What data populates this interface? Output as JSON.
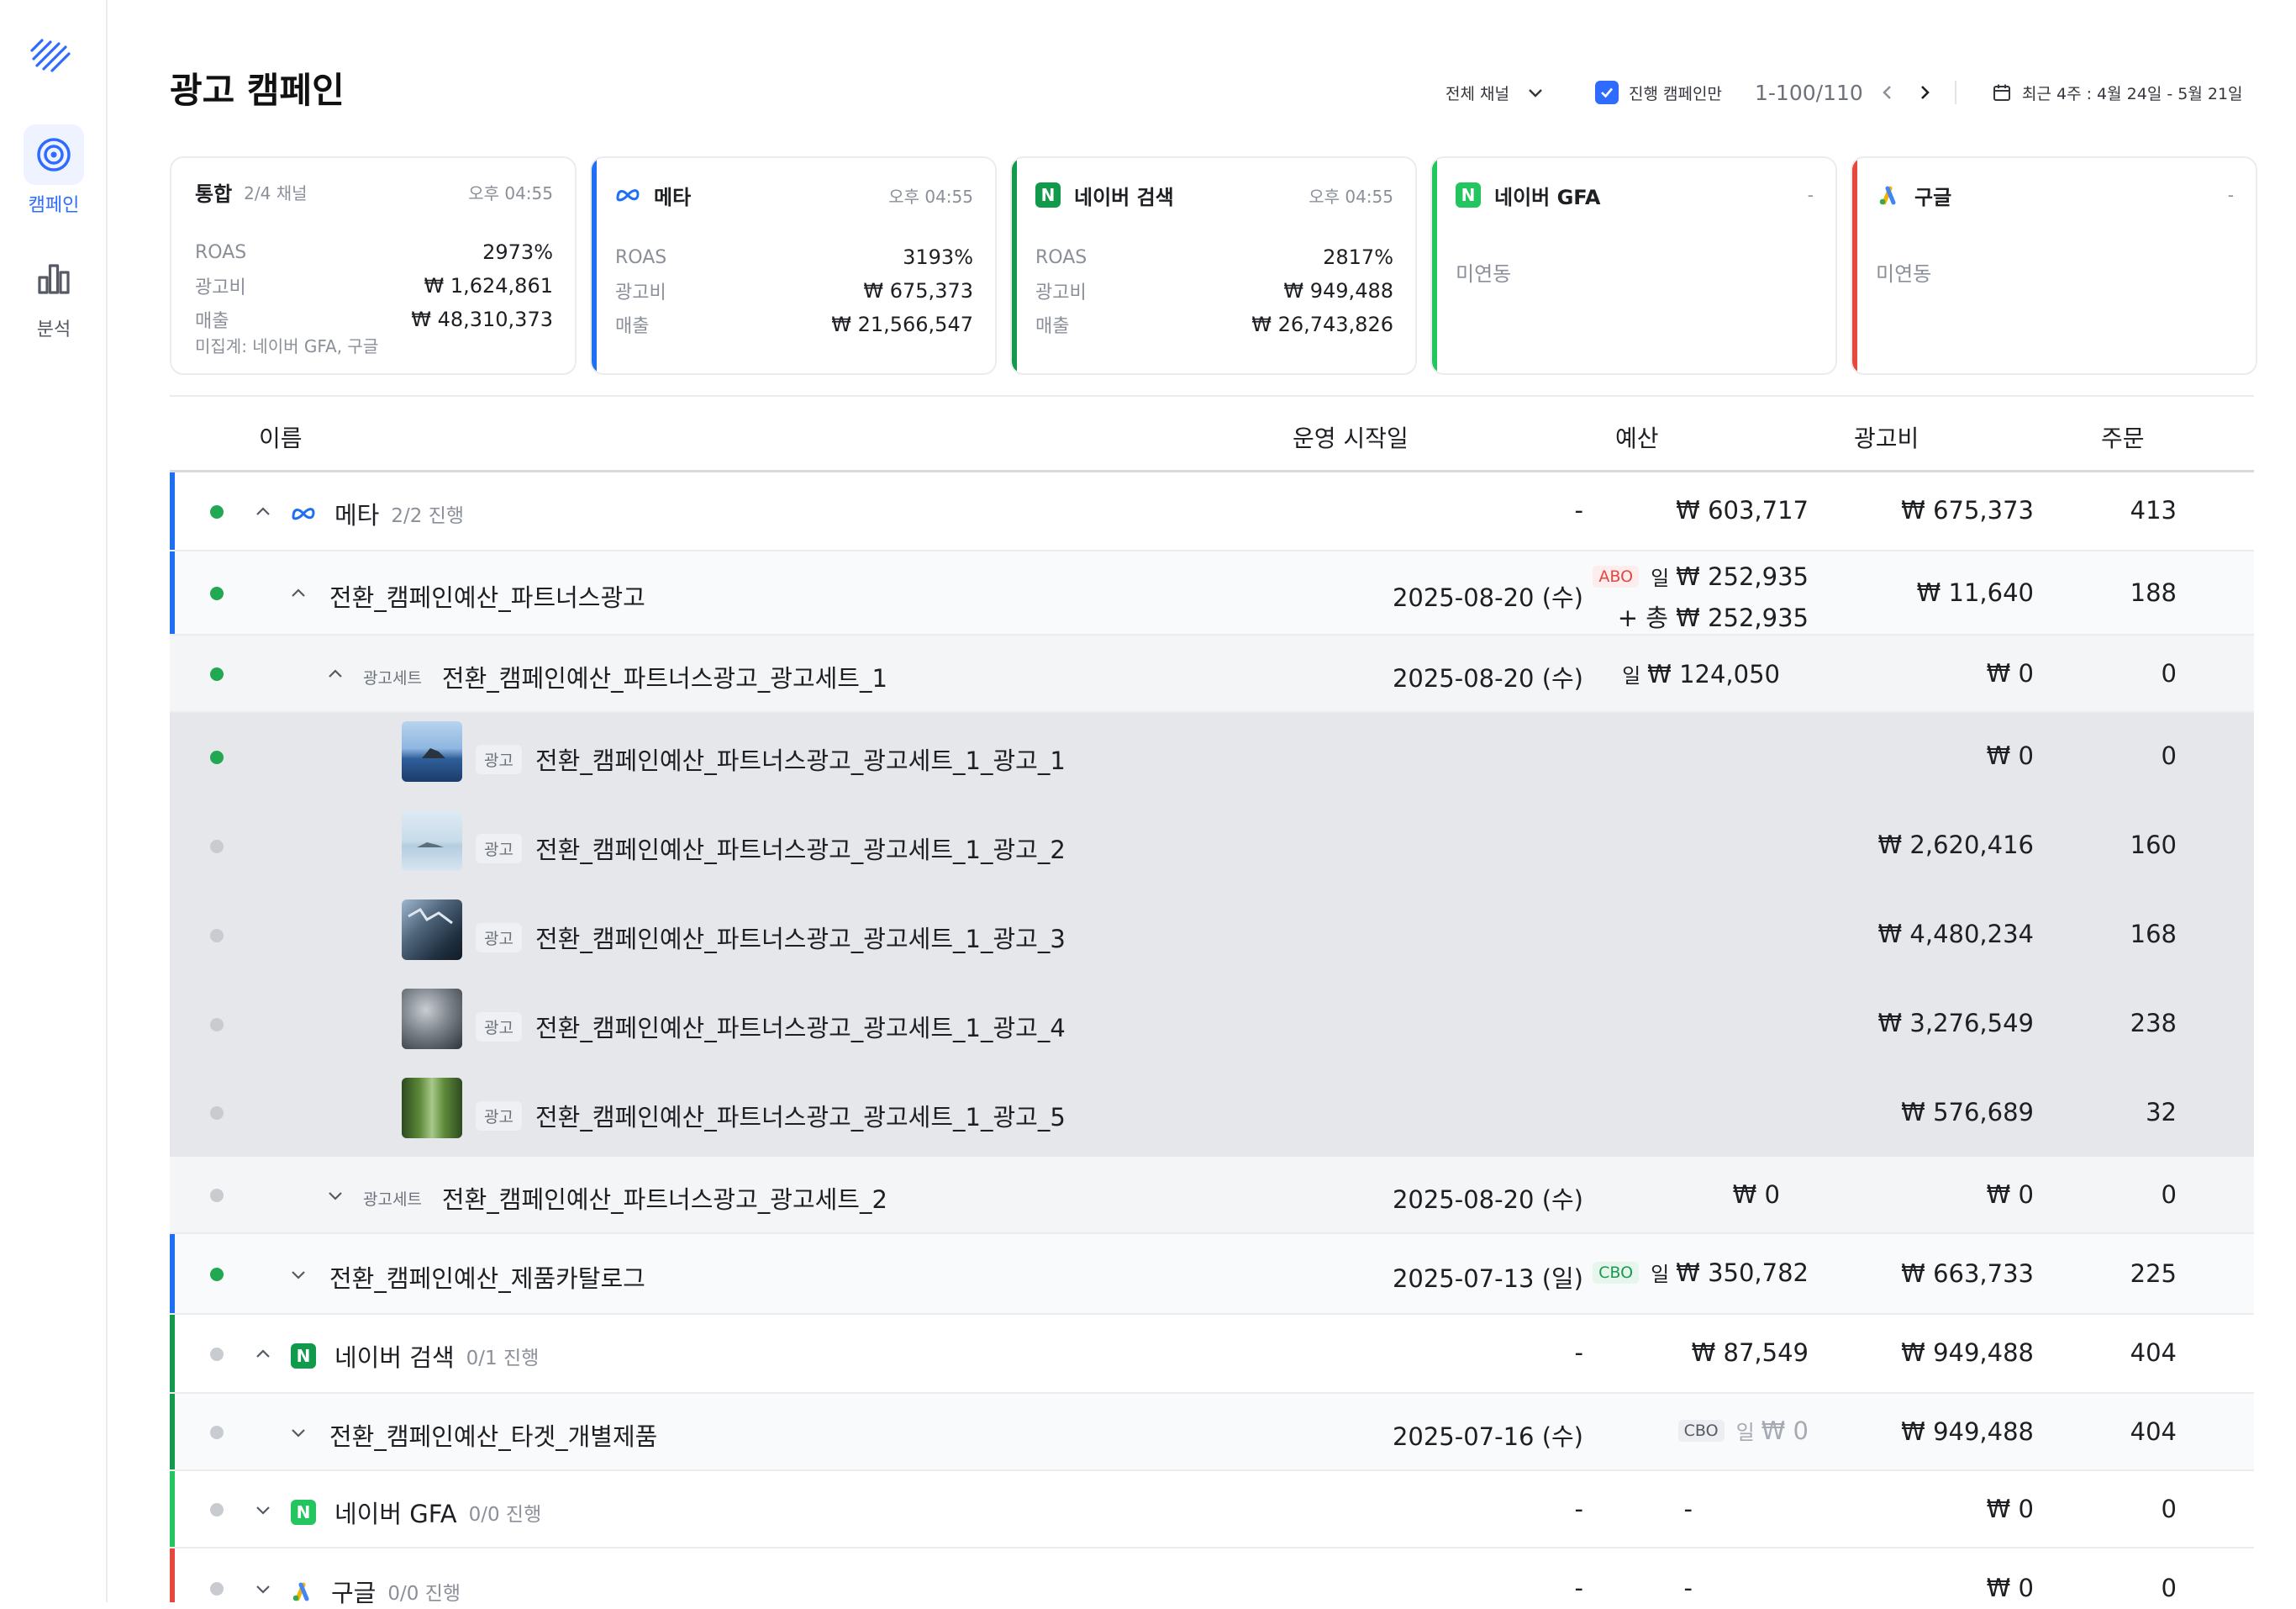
{
  "nav": {
    "items": [
      {
        "label": "캠페인",
        "active": true
      },
      {
        "label": "분석",
        "active": false
      }
    ]
  },
  "header": {
    "title": "광고 캠페인",
    "channel_filter": "전체 채널",
    "active_only_label": "진행 캠페인만",
    "active_only_checked": true,
    "pagination": "1-100/110",
    "date_range": "최근 4주 : 4월 24일 - 5월 21일"
  },
  "colors": {
    "accent": "#2f6bff",
    "meta": "#1f6ff2",
    "naver_search": "#119a4c",
    "naver_gfa": "#22c55e",
    "google": "#e5483f",
    "active_dot": "#22a852",
    "inactive_dot": "#c8cbd0"
  },
  "cards": [
    {
      "name": "통합",
      "sub": "2/4 채널",
      "time": "오후 04:55",
      "metrics": [
        {
          "k": "ROAS",
          "v": "2973%"
        },
        {
          "k": "광고비",
          "v": "₩ 1,624,861"
        },
        {
          "k": "매출",
          "v": "₩ 48,310,373"
        }
      ],
      "note": "미집계: 네이버 GFA, 구글"
    },
    {
      "name": "메타",
      "time": "오후 04:55",
      "icon": "meta-logo-icon",
      "metrics": [
        {
          "k": "ROAS",
          "v": "3193%"
        },
        {
          "k": "광고비",
          "v": "₩ 675,373"
        },
        {
          "k": "매출",
          "v": "₩ 21,566,547"
        }
      ]
    },
    {
      "name": "네이버 검색",
      "time": "오후 04:55",
      "icon": "naver-logo-icon",
      "metrics": [
        {
          "k": "ROAS",
          "v": "2817%"
        },
        {
          "k": "광고비",
          "v": "₩ 949,488"
        },
        {
          "k": "매출",
          "v": "₩ 26,743,826"
        }
      ]
    },
    {
      "name": "네이버 GFA",
      "time": "-",
      "icon": "naver-logo-icon",
      "status": "미연동"
    },
    {
      "name": "구글",
      "time": "-",
      "icon": "google-ads-logo-icon",
      "status": "미연동"
    }
  ],
  "table": {
    "columns": [
      "이름",
      "운영 시작일",
      "예산",
      "광고비",
      "주문"
    ],
    "rows": [
      {
        "name": "메타",
        "count": "2/2 진행",
        "start": "-",
        "budget": "₩ 603,717",
        "spend": "₩ 675,373",
        "orders": "413"
      },
      {
        "name": "전환_캠페인예산_파트너스광고",
        "start": "2025-08-20 (수)",
        "budget_badge": "ABO",
        "budget_day": "일",
        "budget": "₩ 252,935",
        "budget_total": "+ 총 ₩ 252,935",
        "spend": "₩ 11,640",
        "orders": "188"
      },
      {
        "tag": "광고세트",
        "name": "전환_캠페인예산_파트너스광고_광고세트_1",
        "start": "2025-08-20 (수)",
        "budget_day": "일",
        "budget": "₩ 124,050",
        "spend": "₩ 0",
        "orders": "0"
      },
      {
        "tag": "광고",
        "name": "전환_캠페인예산_파트너스광고_광고세트_1_광고_1",
        "spend": "₩ 0",
        "orders": "0"
      },
      {
        "tag": "광고",
        "name": "전환_캠페인예산_파트너스광고_광고세트_1_광고_2",
        "spend": "₩ 2,620,416",
        "orders": "160"
      },
      {
        "tag": "광고",
        "name": "전환_캠페인예산_파트너스광고_광고세트_1_광고_3",
        "spend": "₩ 4,480,234",
        "orders": "168"
      },
      {
        "tag": "광고",
        "name": "전환_캠페인예산_파트너스광고_광고세트_1_광고_4",
        "spend": "₩ 3,276,549",
        "orders": "238"
      },
      {
        "tag": "광고",
        "name": "전환_캠페인예산_파트너스광고_광고세트_1_광고_5",
        "spend": "₩ 576,689",
        "orders": "32"
      },
      {
        "tag": "광고세트",
        "name": "전환_캠페인예산_파트너스광고_광고세트_2",
        "start": "2025-08-20 (수)",
        "budget": "₩ 0",
        "spend": "₩ 0",
        "orders": "0"
      },
      {
        "name": "전환_캠페인예산_제품카탈로그",
        "start": "2025-07-13 (일)",
        "budget_badge": "CBO",
        "budget_day": "일",
        "budget": "₩ 350,782",
        "spend": "₩ 663,733",
        "orders": "225"
      },
      {
        "name": "네이버 검색",
        "count": "0/1 진행",
        "start": "-",
        "budget": "₩ 87,549",
        "spend": "₩ 949,488",
        "orders": "404"
      },
      {
        "name": "전환_캠페인예산_타겟_개별제품",
        "start": "2025-07-16 (수)",
        "budget_badge": "CBO",
        "budget_day": "일",
        "budget": "₩ 0",
        "spend": "₩ 949,488",
        "orders": "404"
      },
      {
        "name": "네이버 GFA",
        "count": "0/0 진행",
        "start": "-",
        "budget": "-",
        "spend": "₩ 0",
        "orders": "0"
      },
      {
        "name": "구글",
        "count": "0/0 진행",
        "start": "-",
        "budget": "-",
        "spend": "₩ 0",
        "orders": "0"
      }
    ]
  }
}
